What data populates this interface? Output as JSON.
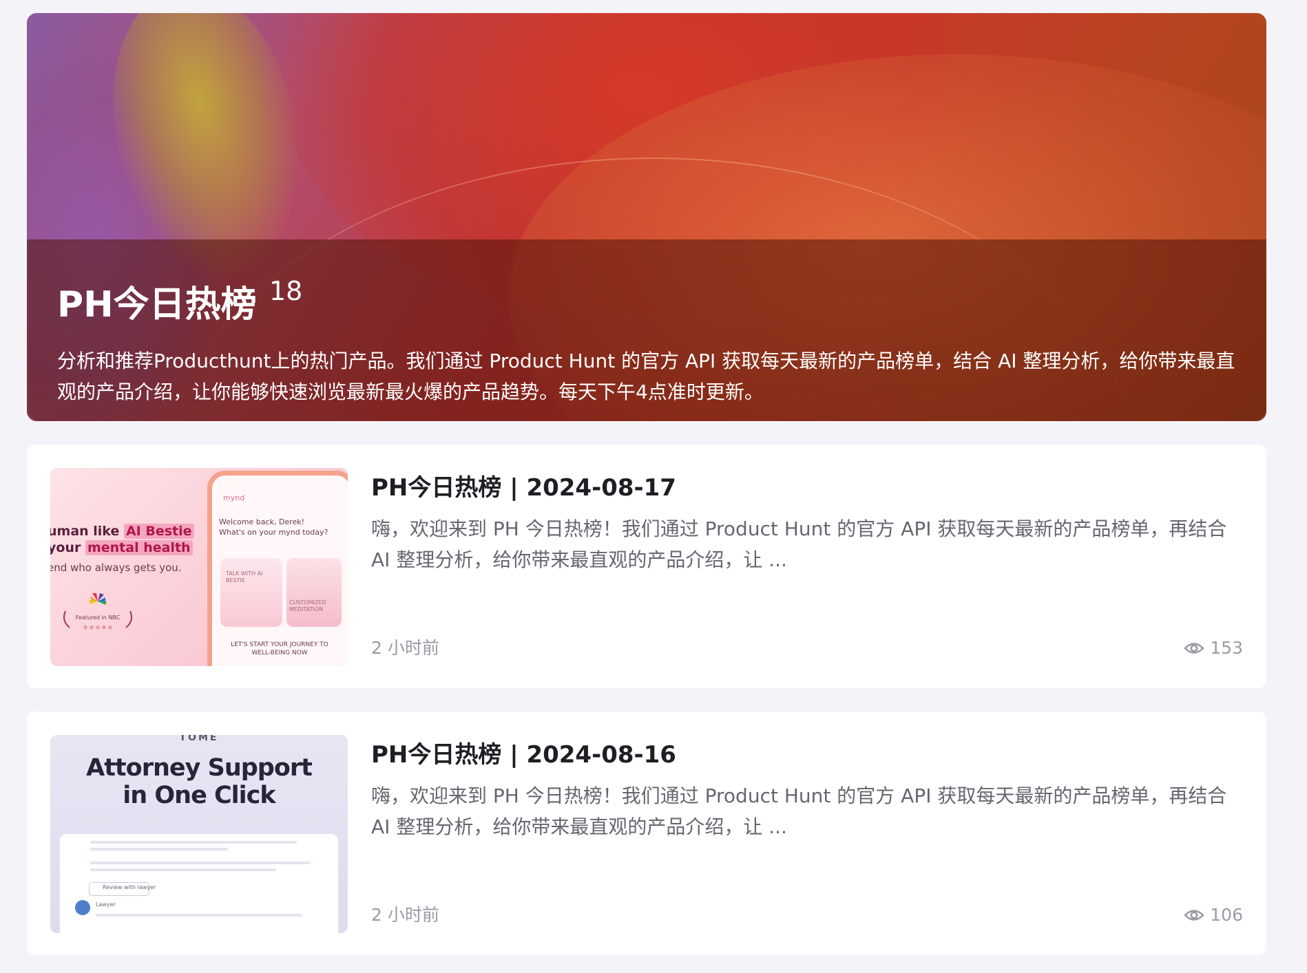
{
  "hero": {
    "title": "PH今日热榜",
    "count": "18",
    "description": "分析和推荐Producthunt上的热门产品。我们通过 Product Hunt 的官方 API 获取每天最新的产品榜单，结合 AI 整理分析，给你带来最直观的产品介绍，让你能够快速浏览最新最火爆的产品趋势。每天下午4点准时更新。"
  },
  "articles": [
    {
      "title": "PH今日热榜 | 2024-08-17",
      "excerpt": "嗨，欢迎来到 PH 今日热榜！我们通过 Product Hunt 的官方 API 获取每天最新的产品榜单，再结合 AI 整理分析，给你带来最直观的产品介绍，让 ...",
      "time": "2 小时前",
      "views": "153",
      "thumbnail": {
        "headline_pre1": "uman like ",
        "headline_hl1": "AI Bestie",
        "headline_pre2": "your ",
        "headline_hl2": "mental health",
        "subline": "end who always gets you.",
        "badge": "Featured in NBC",
        "app_brand": "mynd",
        "welcome": "Welcome back, Derek!",
        "welcome_sub": "What's on your mynd today?",
        "tile1": "TALK WITH AI BESTIE",
        "tile2": "CUSTOMIZED MEDITATION",
        "cta": "LET'S START YOUR JOURNEY TO WELL-BEING NOW"
      }
    },
    {
      "title": "PH今日热榜 | 2024-08-16",
      "excerpt": "嗨，欢迎来到 PH 今日热榜！我们通过 Product Hunt 的官方 API 获取每天最新的产品榜单，再结合 AI 整理分析，给你带来最直观的产品介绍，让 ...",
      "time": "2 小时前",
      "views": "106",
      "thumbnail": {
        "brand": "TOME",
        "headline_line1": "Attorney Support",
        "headline_line2": "in One Click",
        "chip": "Review with lawyer",
        "role": "Lawyer"
      }
    }
  ],
  "icons": {
    "views": "eye-icon"
  },
  "colors": {
    "background": "#f4f4f8",
    "card": "#ffffff",
    "title": "#1e1e24",
    "muted": "#9a9aa4"
  }
}
